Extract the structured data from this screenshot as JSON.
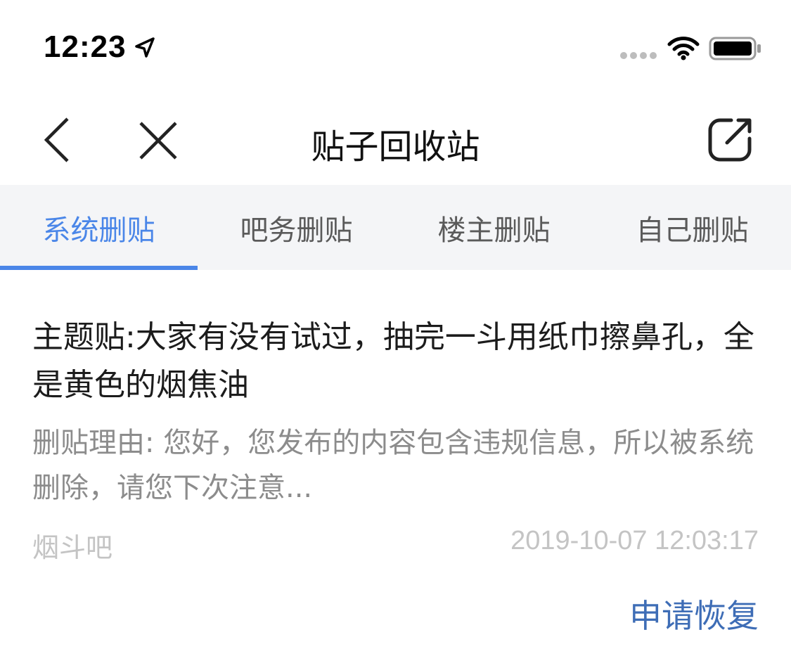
{
  "status_bar": {
    "time": "12:23",
    "location_icon": "location-arrow-icon",
    "signal_icon": "signal-dots-icon",
    "wifi_icon": "wifi-icon",
    "battery_icon": "battery-icon"
  },
  "nav": {
    "title": "贴子回收站",
    "back_icon": "chevron-left-icon",
    "close_icon": "close-icon",
    "share_icon": "share-icon"
  },
  "tabs": [
    {
      "label": "系统删贴",
      "active": true
    },
    {
      "label": "吧务删贴",
      "active": false
    },
    {
      "label": "楼主删贴",
      "active": false
    },
    {
      "label": "自己删贴",
      "active": false
    }
  ],
  "post": {
    "title": "主题贴:大家有没有试过，抽完一斗用纸巾擦鼻孔，全是黄色的烟焦油",
    "reason": "删贴理由: 您好，您发布的内容包含违规信息，所以被系统删除，请您下次注意...",
    "forum": "烟斗吧",
    "time": "2019-10-07 12:03:17",
    "restore_label": "申请恢复"
  },
  "colors": {
    "accent": "#4a86e8",
    "restore": "#3e6db6",
    "tab_bg": "#f4f5f7",
    "muted": "#8c8c8c",
    "faint": "#c4c4c4"
  }
}
